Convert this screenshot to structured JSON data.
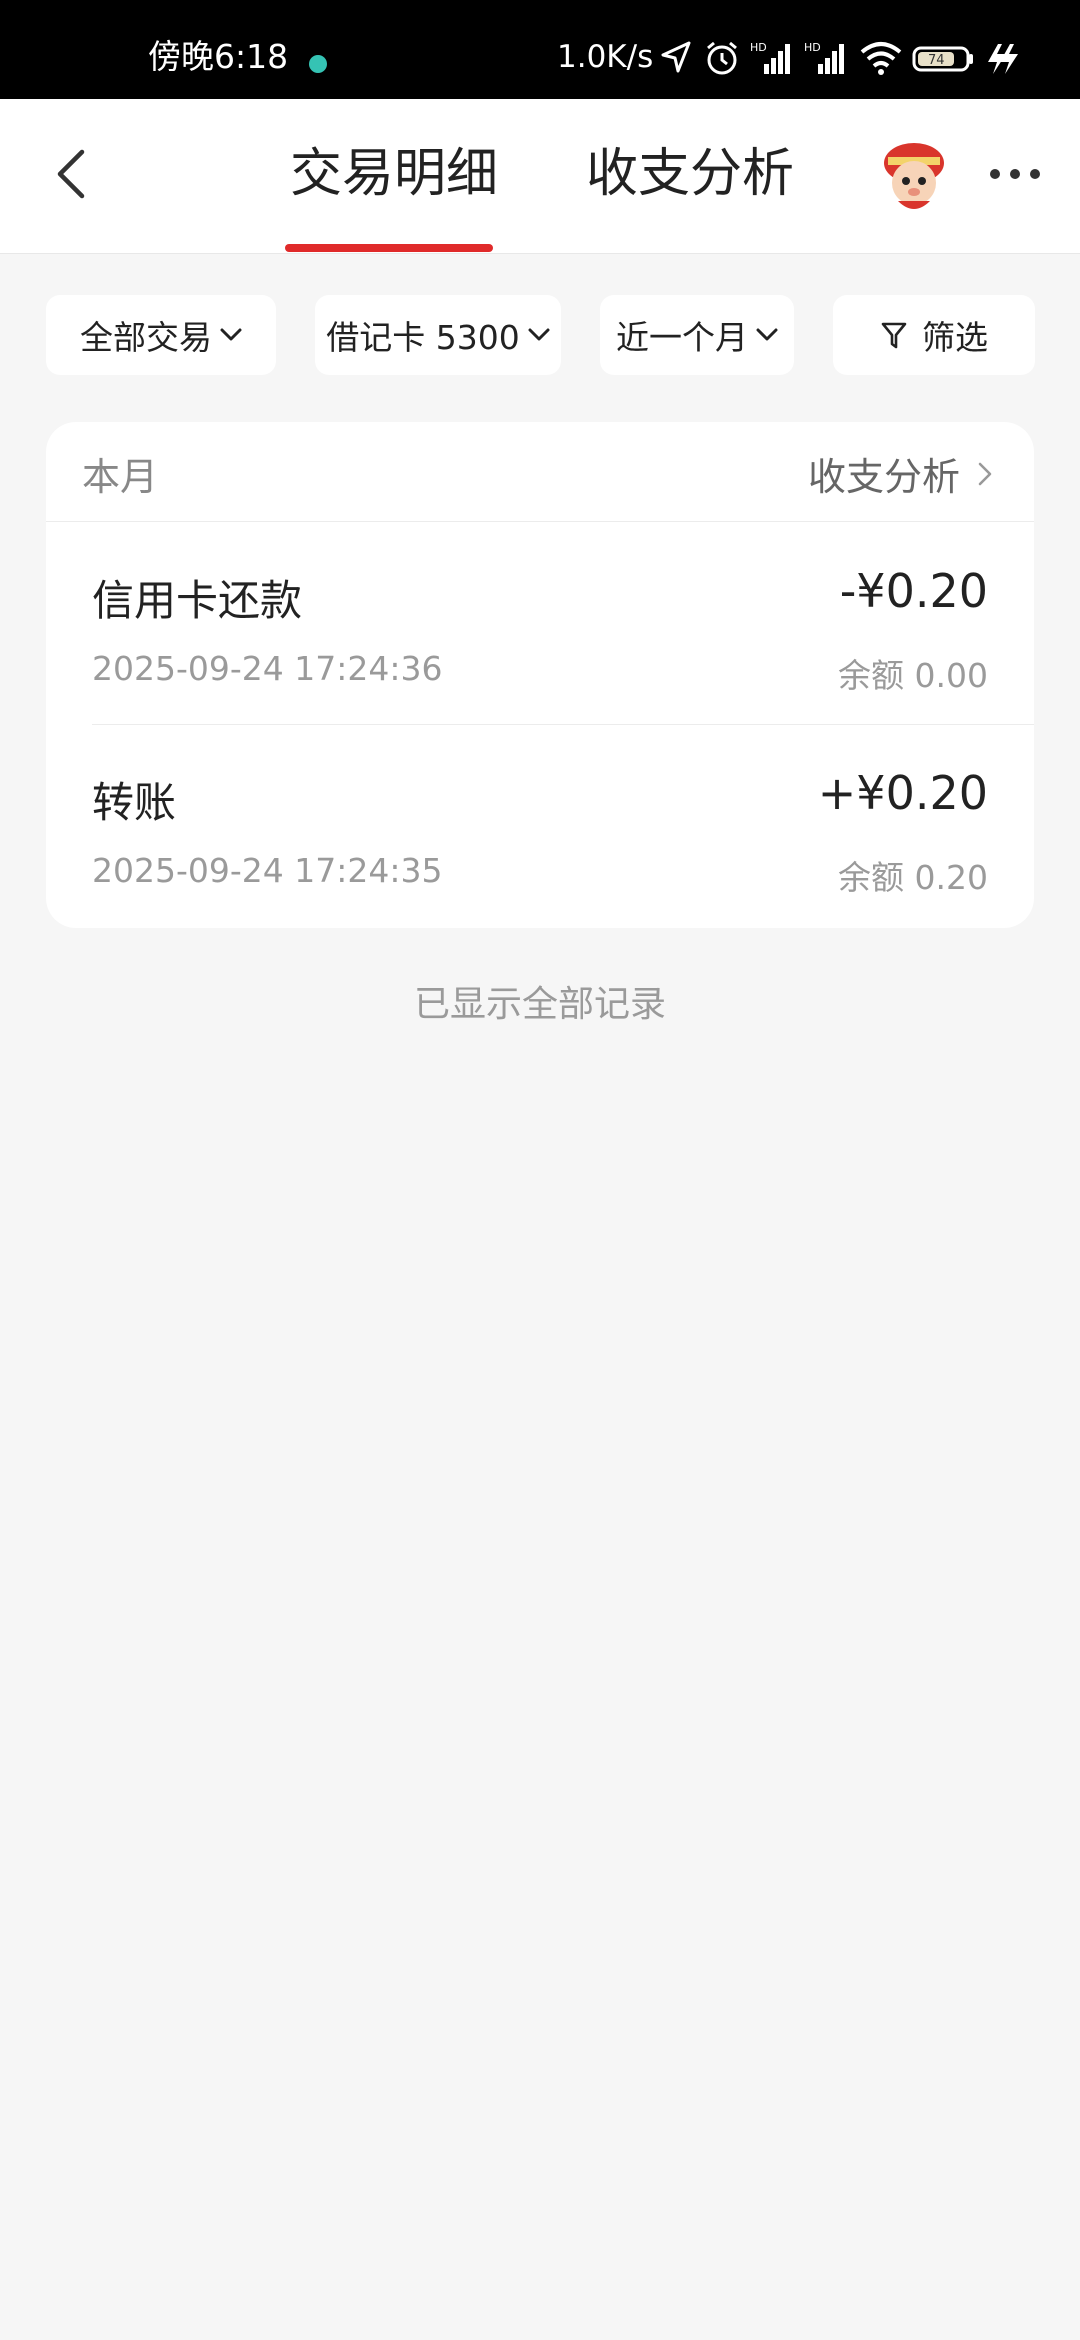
{
  "status_bar": {
    "time": "傍晚6:18",
    "net_speed": "1.0K/s",
    "battery": "74"
  },
  "header": {
    "tabs": [
      {
        "label": "交易明细",
        "active": true
      },
      {
        "label": "收支分析",
        "active": false
      }
    ],
    "accent_color": "#e02a2a"
  },
  "filters": {
    "type": "全部交易",
    "card": "借记卡 5300",
    "period": "近一个月",
    "filter_label": "筛选"
  },
  "card": {
    "title": "本月",
    "link_label": "收支分析",
    "transactions": [
      {
        "name": "信用卡还款",
        "amount": "-¥0.20",
        "time": "2025-09-24 17:24:36",
        "balance": "余额 0.00"
      },
      {
        "name": "转账",
        "amount": "+¥0.20",
        "time": "2025-09-24 17:24:35",
        "balance": "余额 0.20"
      }
    ]
  },
  "end_note": "已显示全部记录"
}
